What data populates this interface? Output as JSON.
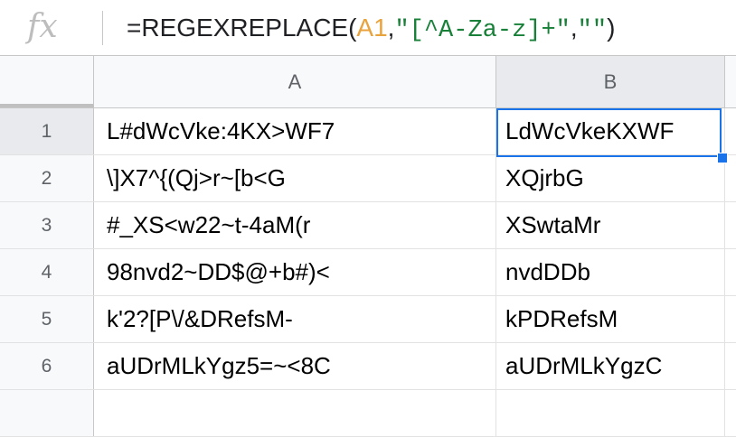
{
  "formula_bar": {
    "icon": "fx-icon",
    "icon_label": "fx",
    "prefix": "=REGEXREPLACE(",
    "ref": "A1",
    "comma1": ",",
    "pattern": "\"[^A-Za-z]+\"",
    "comma2": ",",
    "replacement": "\"\"",
    "suffix": ")"
  },
  "columns": [
    {
      "label": "A"
    },
    {
      "label": "B"
    }
  ],
  "selected_cell": "B1",
  "rows": [
    {
      "num": "1",
      "a": "L#dWcVke:4KX>WF7",
      "b": "LdWcVkeKXWF"
    },
    {
      "num": "2",
      "a": "\\]X7^{(Qj>r~[b<G",
      "b": "XQjrbG"
    },
    {
      "num": "3",
      "a": "#_XS<w22~t-4aM(r",
      "b": "XSwtaMr"
    },
    {
      "num": "4",
      "a": "98nvd2~DD$@+b#)<",
      "b": "nvdDDb"
    },
    {
      "num": "5",
      "a": "k'2?[P\\/&DRefsM-",
      "b": "kPDRefsM"
    },
    {
      "num": "6",
      "a": "aUDrMLkYgz5=~<8C",
      "b": "aUDrMLkYgzC"
    }
  ],
  "colors": {
    "accent": "#1a73e8",
    "ref": "#e8a33d",
    "string": "#188038"
  }
}
